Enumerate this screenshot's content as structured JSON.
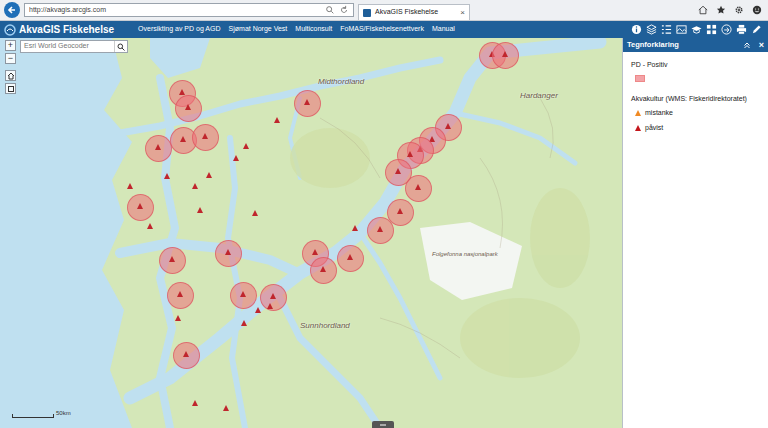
{
  "browser": {
    "address": "http://akvagis.arcgis.com",
    "tabs": [
      {
        "label": "AkvaGIS Fiskehelse",
        "selected": true,
        "close": "×"
      }
    ]
  },
  "app": {
    "title": "AkvaGIS Fiskehelse",
    "menu": [
      "Oversikting av PD og AGD",
      "Sjømat Norge Vest",
      "Multiconsult",
      "FoMAS/Fiskehelsenettverk",
      "Manual"
    ]
  },
  "search": {
    "placeholder": "Esri World Geocoder"
  },
  "zoom": {
    "in": "+",
    "out": "−"
  },
  "map": {
    "labels": [
      "Midthordland",
      "Hardanger",
      "Sunnhordland",
      "Folgefonna nasjonalpark"
    ],
    "scale": "50km"
  },
  "legend": {
    "title": "Tegnforklaring",
    "close": "×",
    "layers": [
      {
        "title": "PD - Positiv",
        "items": [
          {
            "label": "",
            "kind": "swatch",
            "color": "#f3a3a8"
          }
        ]
      },
      {
        "title": "Akvakultur (WMS: Fiskeridirektoratet)",
        "items": [
          {
            "label": "mistanke",
            "kind": "triangle",
            "color": "#f08a24"
          },
          {
            "label": "påvist",
            "kind": "triangle",
            "color": "#c4161c"
          }
        ]
      }
    ]
  }
}
